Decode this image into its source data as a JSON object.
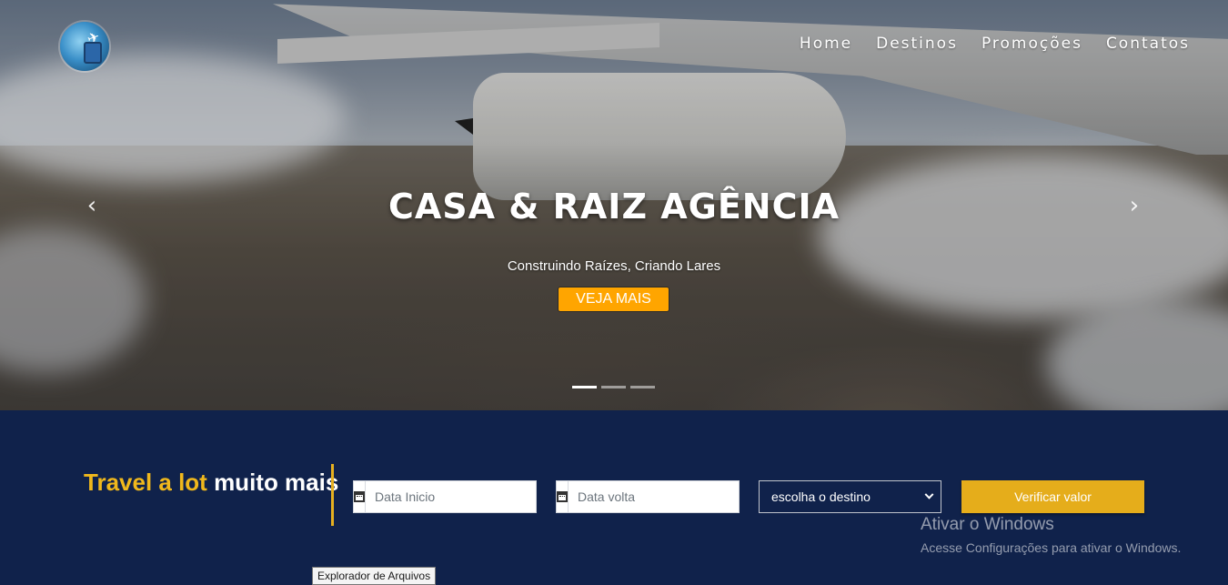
{
  "nav": {
    "items": [
      {
        "label": "Home"
      },
      {
        "label": "Destinos"
      },
      {
        "label": "Promoções"
      },
      {
        "label": "Contatos"
      }
    ]
  },
  "hero": {
    "title": "CASA & RAIZ AGÊNCIA",
    "subtitle": "Construindo Raízes, Criando Lares",
    "cta_label": "VEJA MAIS",
    "slides_count": 3,
    "active_slide": 1,
    "prev_icon": "chevron-left-icon",
    "next_icon": "chevron-right-icon"
  },
  "booking": {
    "tagline_highlight": "Travel a lot",
    "tagline_rest": " muito mais",
    "start_date": {
      "placeholder": "Data Inicio",
      "value": "",
      "icon": "calendar-icon"
    },
    "return_date": {
      "placeholder": "Data volta",
      "value": "",
      "icon": "calendar-icon"
    },
    "destination": {
      "selected": "escolha o destino"
    },
    "submit_label": "Verificar valor"
  },
  "colors": {
    "navy": "#10224b",
    "accent": "#f0b81c",
    "cta_orange": "#ffa500",
    "button_gold": "#e5ad1b"
  },
  "system": {
    "watermark_title": "Ativar o Windows",
    "watermark_text": "Acesse Configurações para ativar o Windows.",
    "tooltip": "Explorador de Arquivos"
  }
}
